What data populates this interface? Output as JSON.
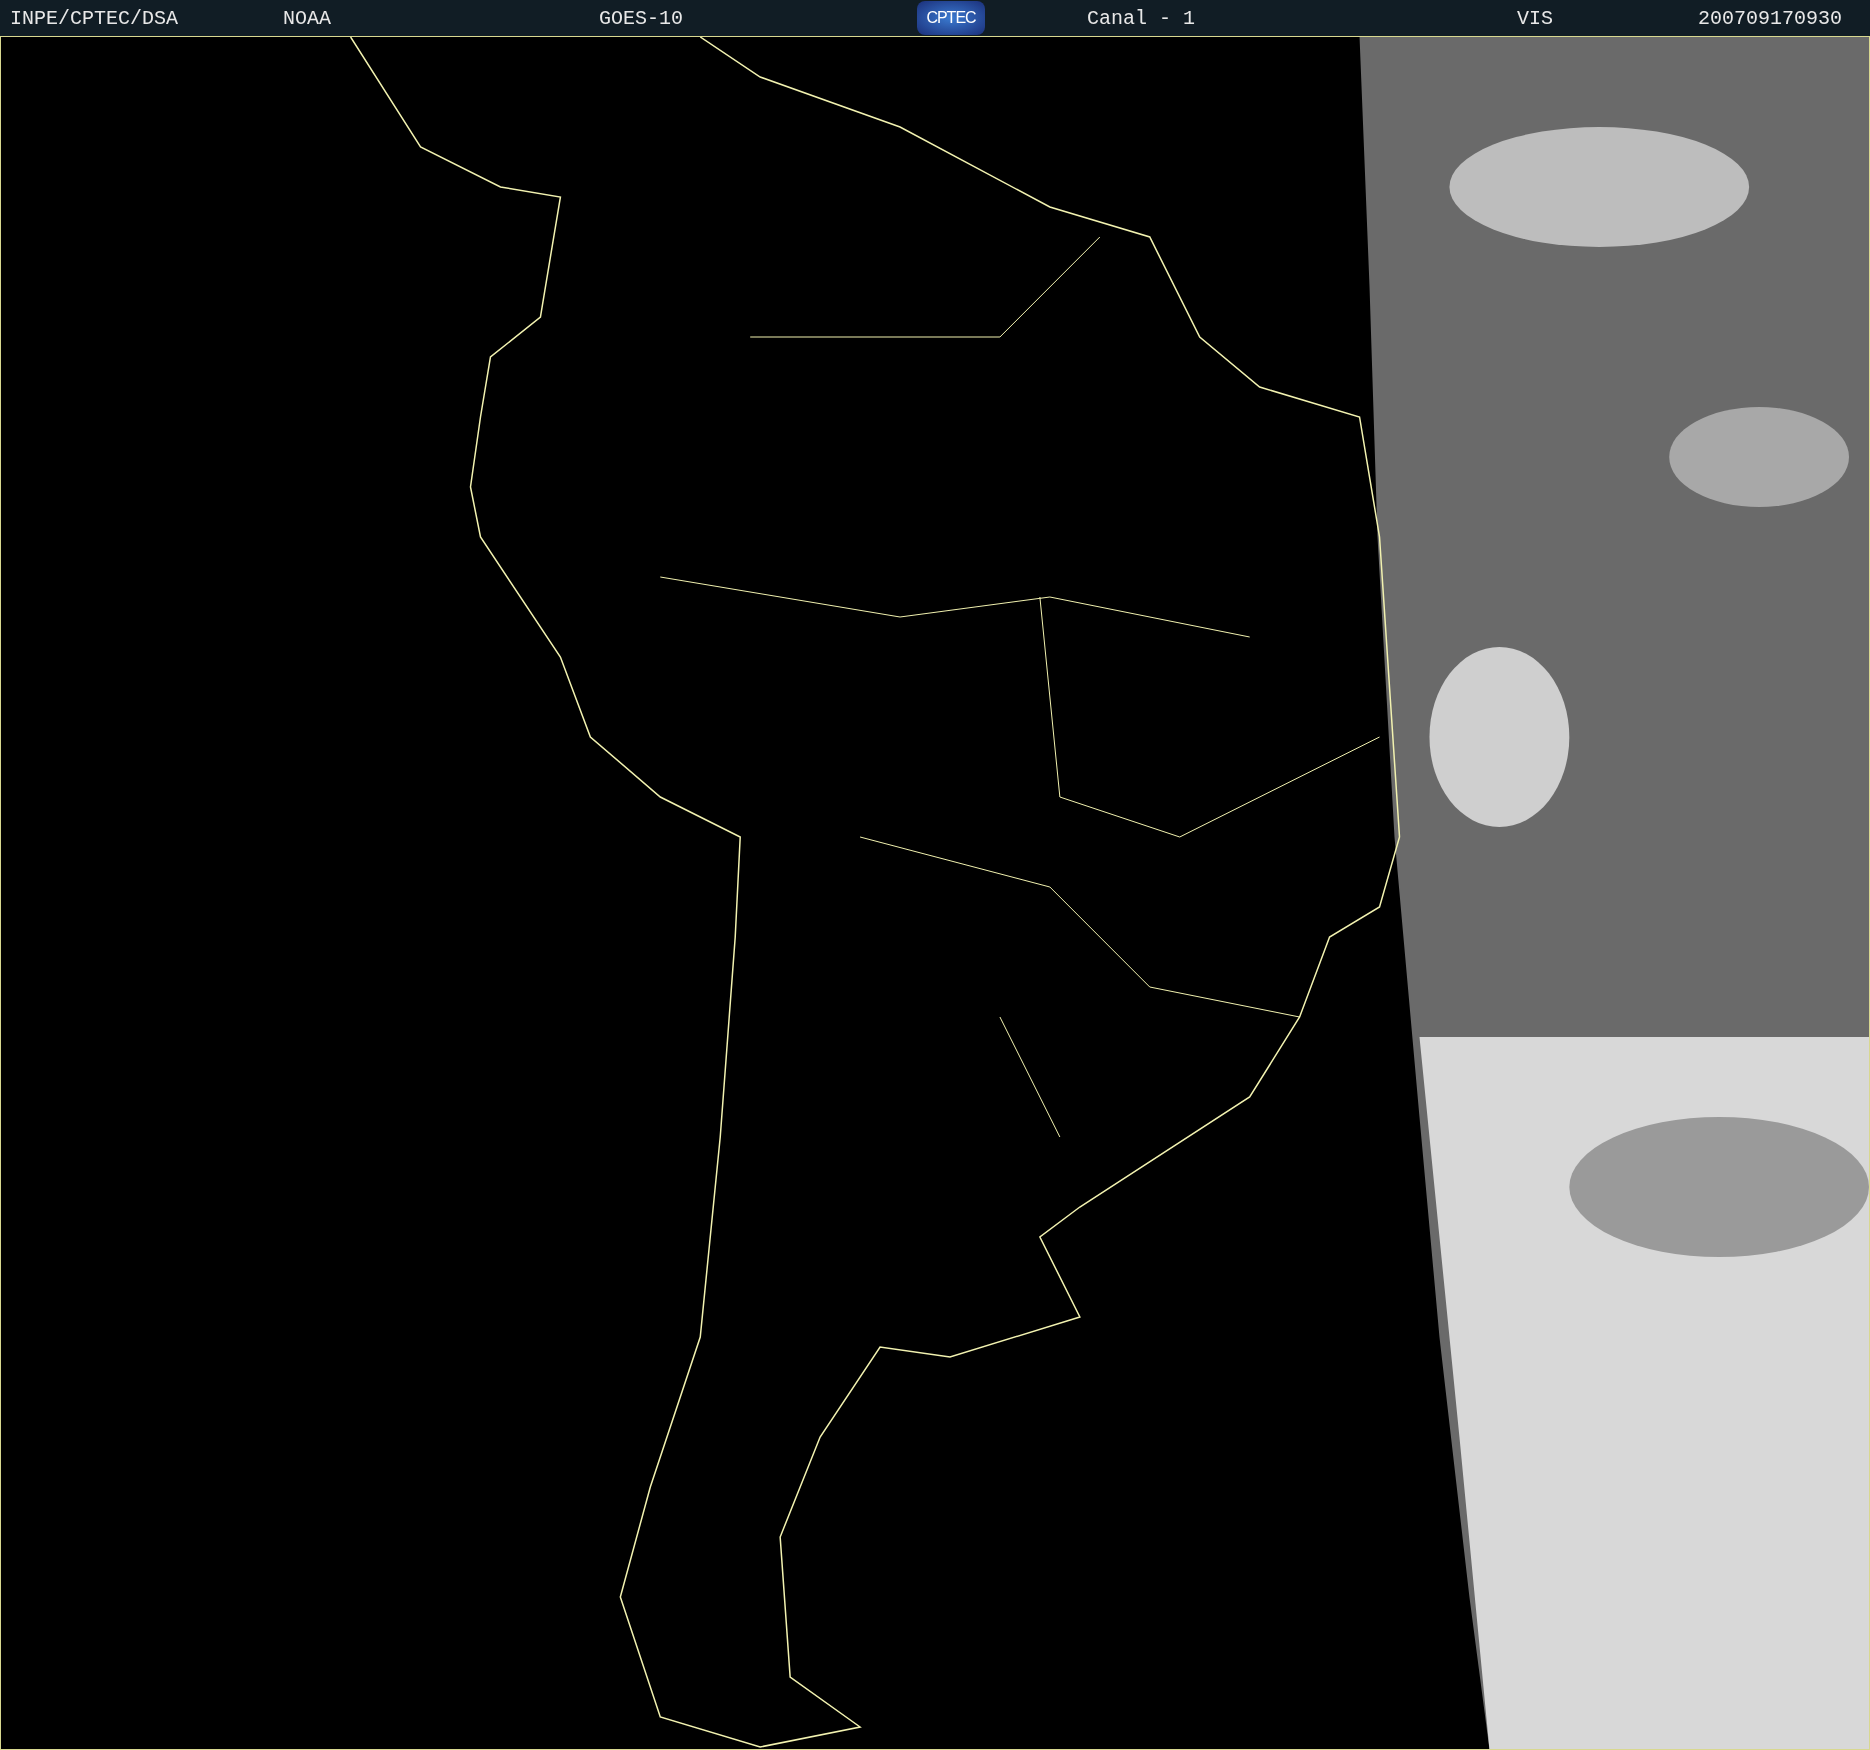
{
  "header": {
    "items": [
      {
        "kind": "text",
        "text": "INPE/CPTEC/DSA"
      },
      {
        "kind": "text",
        "text": "NOAA"
      },
      {
        "kind": "text",
        "text": "GOES-10"
      },
      {
        "kind": "logo",
        "text": "CPTEC"
      },
      {
        "kind": "text",
        "text": "Canal - 1"
      },
      {
        "kind": "text",
        "text": "VIS"
      },
      {
        "kind": "text",
        "text": "200709170930"
      }
    ]
  }
}
